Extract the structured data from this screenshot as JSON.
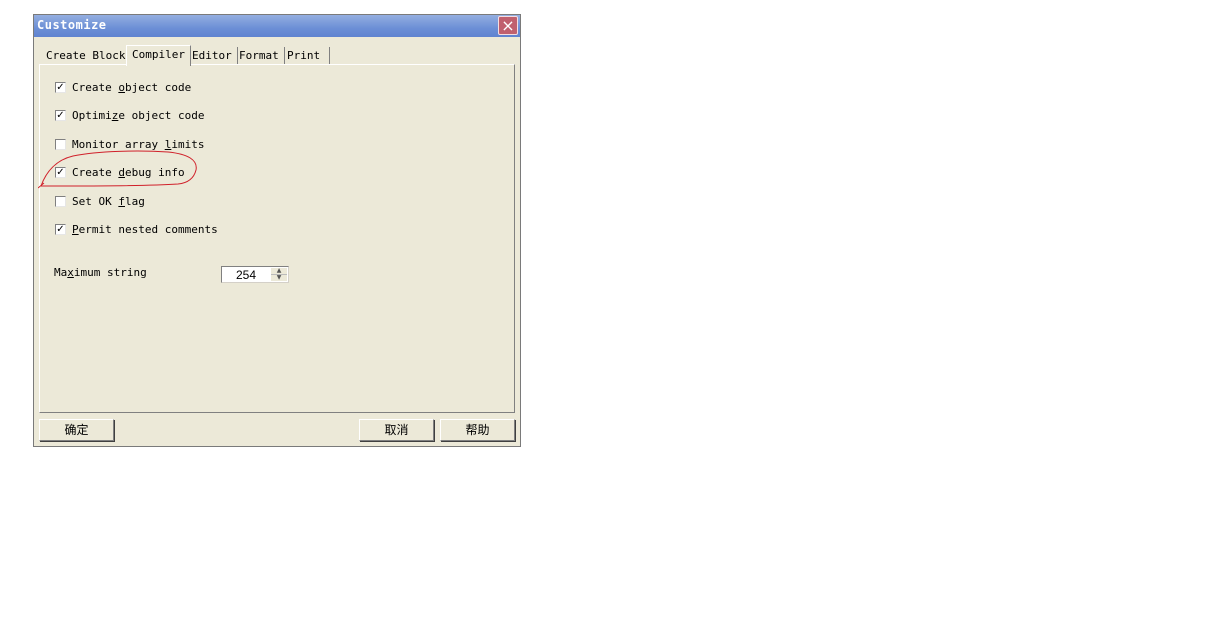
{
  "dialog": {
    "title": "Customize",
    "close_icon": "×"
  },
  "tabs": [
    {
      "label": "Create Block",
      "active": false
    },
    {
      "label": "Compiler",
      "active": true
    },
    {
      "label": "Editor",
      "active": false
    },
    {
      "label": "Format",
      "active": false
    },
    {
      "label": "Print",
      "active": false
    }
  ],
  "options": [
    {
      "pre": "Create ",
      "mnemonic": "o",
      "post": "bject code",
      "checked": true
    },
    {
      "pre": "Optimi",
      "mnemonic": "z",
      "post": "e object code",
      "checked": true
    },
    {
      "pre": "Monitor array ",
      "mnemonic": "l",
      "post": "imits",
      "checked": false
    },
    {
      "pre": "Create ",
      "mnemonic": "d",
      "post": "ebug info",
      "checked": true
    },
    {
      "pre": "Set OK ",
      "mnemonic": "f",
      "post": "lag",
      "checked": false
    },
    {
      "pre": "",
      "mnemonic": "P",
      "post": "ermit nested comments",
      "checked": true
    }
  ],
  "max_string": {
    "label_pre": "Ma",
    "label_mnemonic": "x",
    "label_post": "imum string",
    "value": "254"
  },
  "check_glyph": "✓",
  "buttons": {
    "ok": "确定",
    "cancel": "取消",
    "help": "帮助"
  },
  "annotation": {
    "color": "#d0202a",
    "target": "Create debug info"
  }
}
